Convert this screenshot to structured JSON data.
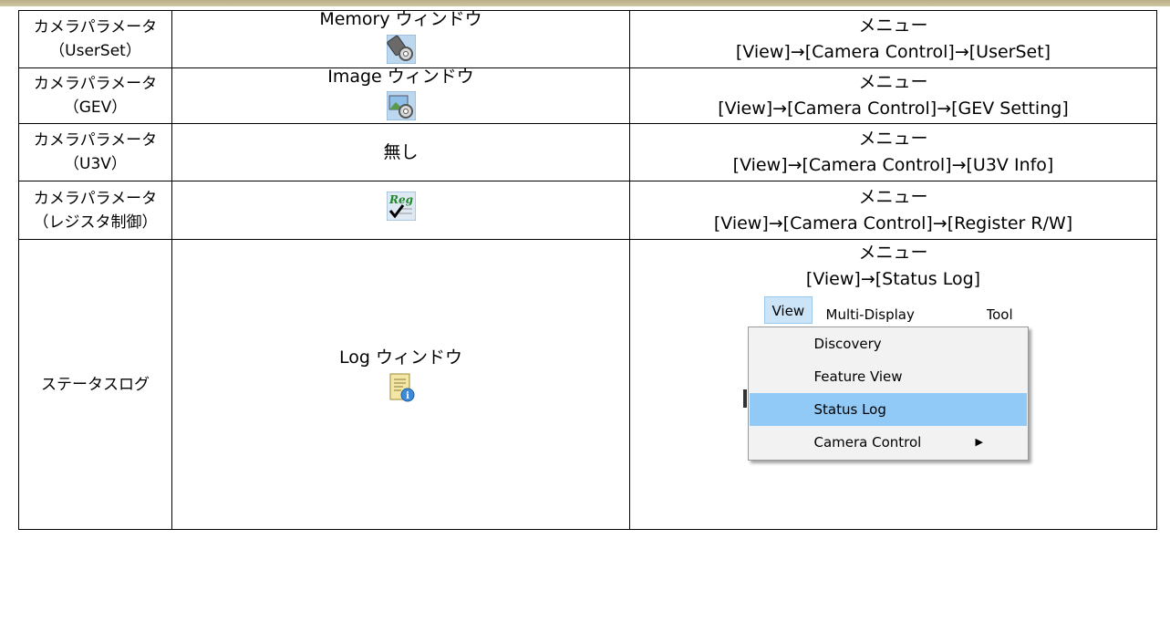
{
  "rows": [
    {
      "feature": [
        "カメラパラメータ",
        "（UserSet）"
      ],
      "tool_label": "Memory ウィンドウ",
      "tool_icon": "memory-settings-icon",
      "menu": [
        "メニュー",
        "[View]→[Camera Control]→[UserSet]"
      ]
    },
    {
      "feature": [
        "カメラパラメータ",
        "（GEV）"
      ],
      "tool_label": "Image ウィンドウ",
      "tool_icon": "image-settings-icon",
      "menu": [
        "メニュー",
        "[View]→[Camera Control]→[GEV Setting]"
      ]
    },
    {
      "feature": [
        "カメラパラメータ",
        "（U3V）"
      ],
      "tool_label": "無し",
      "menu": [
        "メニュー",
        "[View]→[Camera Control]→[U3V Info]"
      ]
    },
    {
      "feature": [
        "カメラパラメータ",
        "（レジスタ制御）"
      ],
      "tool_icon": "register-check-icon",
      "tool_icon_text": "Reg",
      "menu": [
        "メニュー",
        "[View]→[Camera Control]→[Register R/W]"
      ]
    },
    {
      "feature": [
        "ステータスログ"
      ],
      "tool_label": "Log ウィンドウ",
      "tool_icon": "log-info-icon",
      "menu": [
        "メニュー",
        "[View]→[Status Log]"
      ]
    }
  ],
  "menu_screenshot": {
    "menubar": [
      "View",
      "Multi-Display",
      "Tool"
    ],
    "items": [
      "Discovery",
      "Feature View",
      "Status Log",
      "Camera Control"
    ],
    "selected": "Status Log"
  }
}
